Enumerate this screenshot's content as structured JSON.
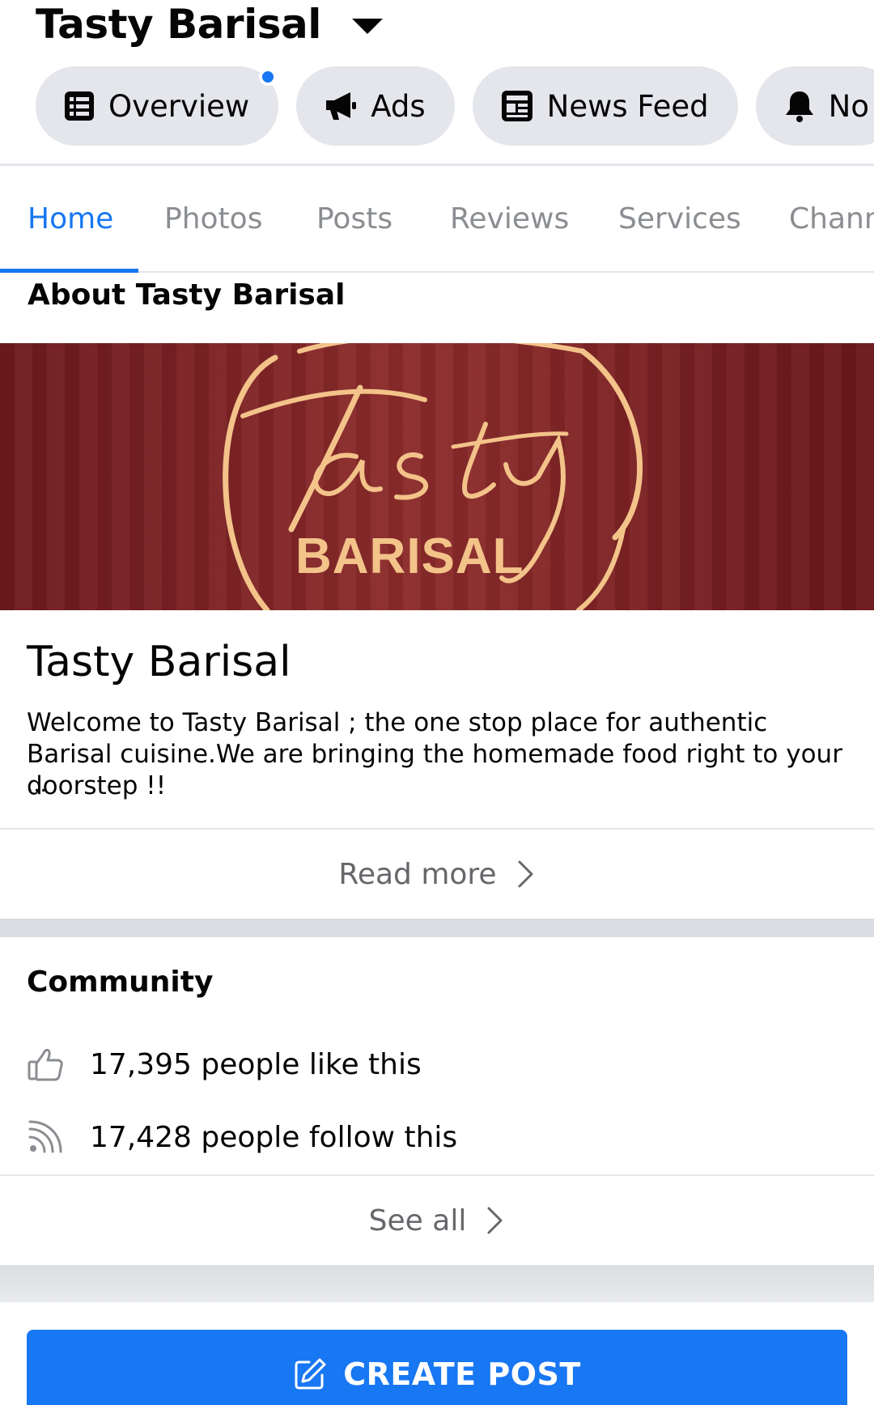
{
  "header": {
    "title": "Tasty Barisal",
    "chips": [
      {
        "label": "Overview",
        "icon": "list-icon",
        "has_notification_dot": true
      },
      {
        "label": "Ads",
        "icon": "megaphone-icon"
      },
      {
        "label": "News Feed",
        "icon": "news-feed-icon"
      },
      {
        "label": "No",
        "icon": "bell-icon"
      }
    ]
  },
  "tabs": [
    {
      "label": "Home",
      "active": true
    },
    {
      "label": "Photos"
    },
    {
      "label": "Posts"
    },
    {
      "label": "Reviews"
    },
    {
      "label": "Services"
    },
    {
      "label": "Chann"
    }
  ],
  "about": {
    "title": "About Tasty Barisal",
    "cover_logo_text": "BARISAL",
    "name": "Tasty Barisal",
    "description": "Welcome to Tasty Barisal ; the one stop place for authentic Barisal cuisine.We are bringing the homemade food right to your doorstep !!",
    "ellipsis": "...",
    "read_more": "Read more"
  },
  "community": {
    "title": "Community",
    "likes": "17,395 people like this",
    "follows": "17,428 people follow this",
    "see_all": "See all"
  },
  "actions": {
    "create_post": "CREATE POST"
  },
  "colors": {
    "accent": "#1877f2",
    "chip_bg": "#e4e6eb",
    "cover_red": "#7a2123",
    "logo_gold": "#f3c38a"
  }
}
